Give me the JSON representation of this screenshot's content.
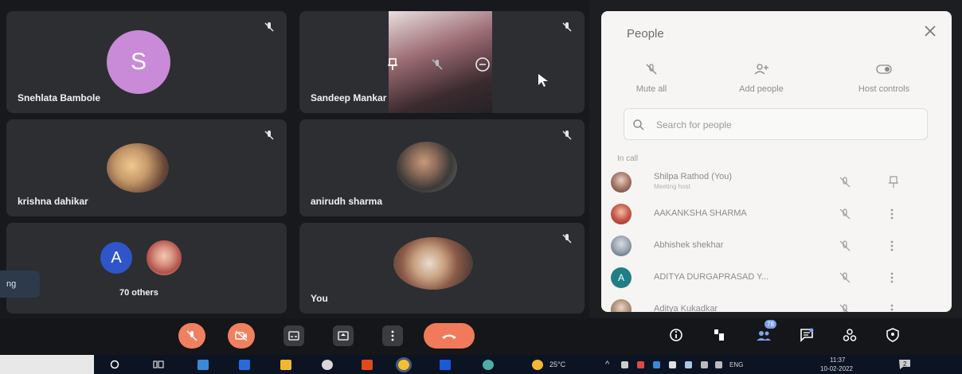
{
  "participants": [
    {
      "name": "Snehlata Bambole",
      "avatar_letter": "S",
      "avatar_color": "#c98ad8"
    },
    {
      "name": "Sandeep Mankar"
    },
    {
      "name": "krishna dahikar"
    },
    {
      "name": "anirudh sharma"
    },
    {
      "label": "70 others",
      "avatar_letter": "A",
      "avatar_color": "#2f55c8"
    },
    {
      "name": "You"
    }
  ],
  "side_tab": {
    "label": "ng"
  },
  "people_panel": {
    "title": "People",
    "actions": [
      {
        "label": "Mute all",
        "icon": "mic-off-icon"
      },
      {
        "label": "Add people",
        "icon": "add-person-icon"
      },
      {
        "label": "Host controls",
        "icon": "toggle-icon"
      }
    ],
    "search_placeholder": "Search for people",
    "section_label": "In call",
    "people": [
      {
        "name": "Shilpa Rathod (You)",
        "sub": "Meeting host"
      },
      {
        "name": "AAKANKSHA SHARMA"
      },
      {
        "name": "Abhishek shekhar"
      },
      {
        "name": "ADITYA DURGAPRASAD Y...",
        "avatar_letter": "A",
        "avatar_color": "#1f7f86"
      },
      {
        "name": "Aditya Kukadkar"
      }
    ]
  },
  "controls": {
    "people_count": "78"
  },
  "taskbar": {
    "temperature": "25°C",
    "language": "ENG",
    "time": "11:37",
    "date": "10-02-2022",
    "notifications": "2"
  },
  "colors": {
    "accent_red": "#f08060",
    "panel_bg": "#f6f5f3",
    "tile_bg": "#2c2e32"
  }
}
